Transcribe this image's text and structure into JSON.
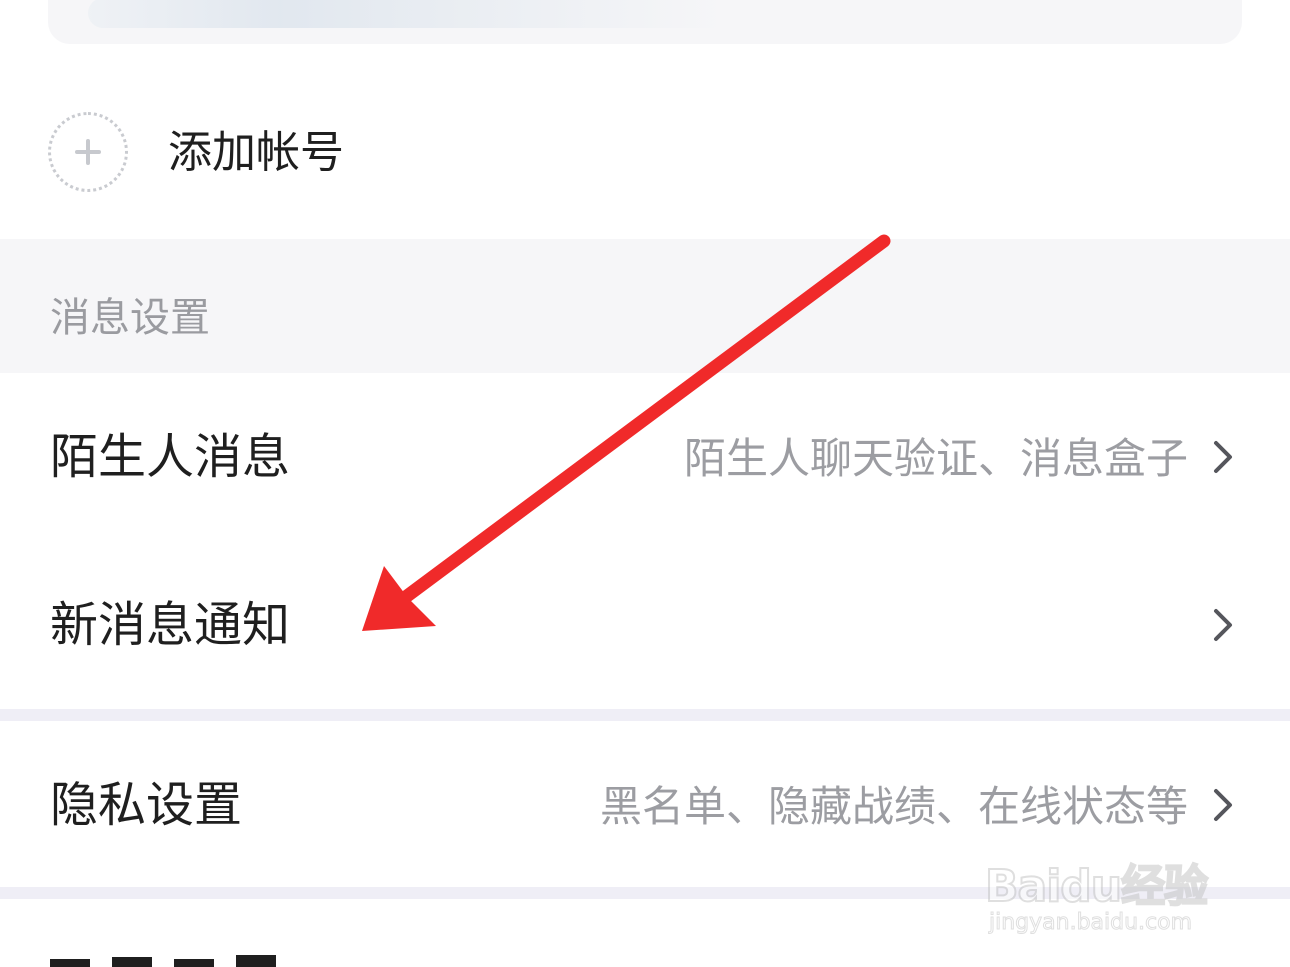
{
  "add_account": {
    "label": "添加帐号"
  },
  "message_settings": {
    "section_title": "消息设置",
    "items": [
      {
        "label": "陌生人消息",
        "sub": "陌生人聊天验证、消息盒子"
      },
      {
        "label": "新消息通知",
        "sub": ""
      }
    ]
  },
  "privacy": {
    "label": "隐私设置",
    "sub": "黑名单、隐藏战绩、在线状态等"
  },
  "watermark": {
    "logo_text": "Baidu经验",
    "url": "jingyan.baidu.com"
  },
  "colors": {
    "annotation_arrow": "#f02a2a",
    "section_background": "#f6f6f8",
    "secondary_text": "#9c9da2"
  },
  "icons": {
    "add": "plus-icon",
    "chevron": "chevron-right-icon",
    "annotation": "arrow-icon"
  }
}
